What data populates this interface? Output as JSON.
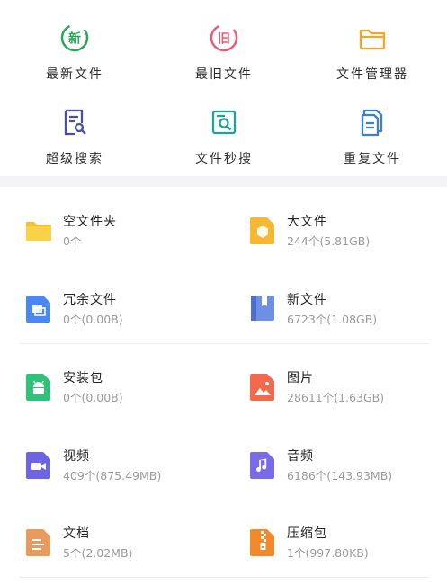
{
  "tools": [
    {
      "label": "最新文件",
      "icon": "new-badge-icon",
      "badge": "新",
      "color": "#27a55a"
    },
    {
      "label": "最旧文件",
      "icon": "old-badge-icon",
      "badge": "旧",
      "color": "#ea5a78"
    },
    {
      "label": "文件管理器",
      "icon": "folder-outline-icon",
      "color": "#f3a629"
    },
    {
      "label": "超级搜索",
      "icon": "document-search-icon",
      "color": "#4b4fa8"
    },
    {
      "label": "文件秒搜",
      "icon": "image-search-icon",
      "color": "#1ca58f"
    },
    {
      "label": "重复文件",
      "icon": "duplicate-files-icon",
      "color": "#3b7ed8"
    }
  ],
  "categories": [
    {
      "name": "空文件夹",
      "meta": "0个",
      "icon": "folder-icon",
      "color": "#f8c22e"
    },
    {
      "name": "大文件",
      "meta": "244个(5.81GB)",
      "icon": "large-file-icon",
      "color": "#f6b731"
    },
    {
      "name": "冗余文件",
      "meta": "0个(0.00B)",
      "icon": "redundant-file-icon",
      "color": "#4a86f4"
    },
    {
      "name": "新文件",
      "meta": "6723个(1.08GB)",
      "icon": "new-file-book-icon",
      "color": "#6d8fe6"
    },
    {
      "name": "安装包",
      "meta": "0个(0.00B)",
      "icon": "android-package-icon",
      "color": "#2fc27a"
    },
    {
      "name": "图片",
      "meta": "28611个(1.63GB)",
      "icon": "picture-icon",
      "color": "#f26a4e"
    },
    {
      "name": "视频",
      "meta": "409个(875.49MB)",
      "icon": "video-icon",
      "color": "#6c63e6"
    },
    {
      "name": "音频",
      "meta": "6186个(143.93MB)",
      "icon": "music-icon",
      "color": "#7a6ae8"
    },
    {
      "name": "文档",
      "meta": "5个(2.02MB)",
      "icon": "document-icon",
      "color": "#e99a5c"
    },
    {
      "name": "压缩包",
      "meta": "1个(997.80KB)",
      "icon": "zip-archive-icon",
      "color": "#f28a2b"
    }
  ]
}
